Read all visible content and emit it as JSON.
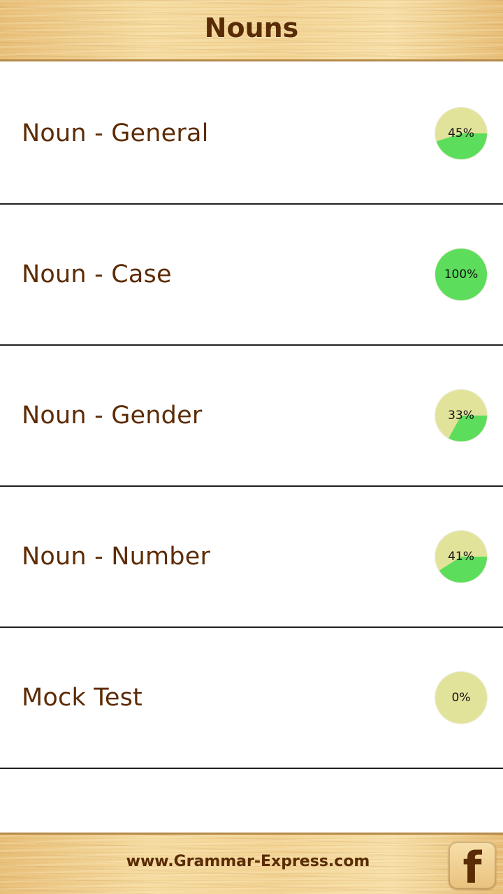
{
  "header": {
    "title": "Nouns"
  },
  "colors": {
    "label_text": "#5d2c05",
    "pie_track": "#e2e39a",
    "pie_fill": "#5ddd5c",
    "wood": "#f0cf8f"
  },
  "topics": [
    {
      "label": "Noun - General",
      "progress_label": "45%",
      "progress": 45
    },
    {
      "label": "Noun - Case",
      "progress_label": "100%",
      "progress": 100
    },
    {
      "label": "Noun - Gender",
      "progress_label": "33%",
      "progress": 33
    },
    {
      "label": "Noun - Number",
      "progress_label": "41%",
      "progress": 41
    },
    {
      "label": "Mock Test",
      "progress_label": "0%",
      "progress": 0
    }
  ],
  "footer": {
    "link_text": "www.Grammar-Express.com",
    "facebook_glyph": "f",
    "facebook_icon": "facebook-icon"
  }
}
